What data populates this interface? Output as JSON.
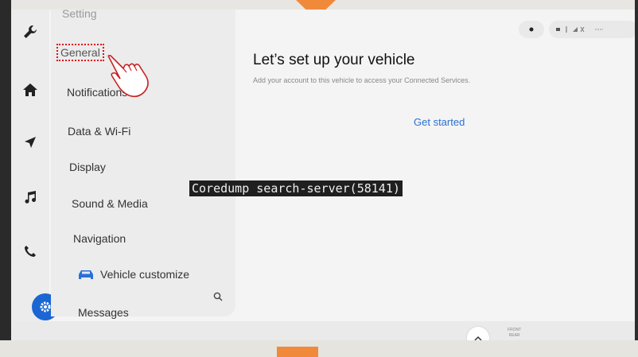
{
  "menu": {
    "title": "Setting",
    "items": [
      {
        "label": "General"
      },
      {
        "label": "Notifications"
      },
      {
        "label": "Data & Wi-Fi"
      },
      {
        "label": "Display"
      },
      {
        "label": "Sound & Media"
      },
      {
        "label": "Navigation"
      },
      {
        "label": "Vehicle customize"
      },
      {
        "label": "Messages"
      }
    ]
  },
  "content": {
    "title": "Let’s set up your vehicle",
    "subtitle": "Add your account to this vehicle to access your Connected Services.",
    "cta": "Get started"
  },
  "bottom": {
    "label_top": "FRONT",
    "label_bottom": "REAR"
  },
  "overlay": {
    "text": "Coredump search-server(58141)"
  },
  "colors": {
    "accent": "#1b66d2",
    "link": "#2a6fd6",
    "highlight": "#d11111",
    "marker": "#f08a3a"
  },
  "icons": {
    "rail": [
      "wrench-icon",
      "home-icon",
      "navigation-arrow-icon",
      "music-note-icon",
      "phone-icon",
      "settings-gear-icon"
    ],
    "menu": [
      "car-icon",
      "search-icon"
    ],
    "bottom": [
      "chevron-up-icon"
    ]
  }
}
